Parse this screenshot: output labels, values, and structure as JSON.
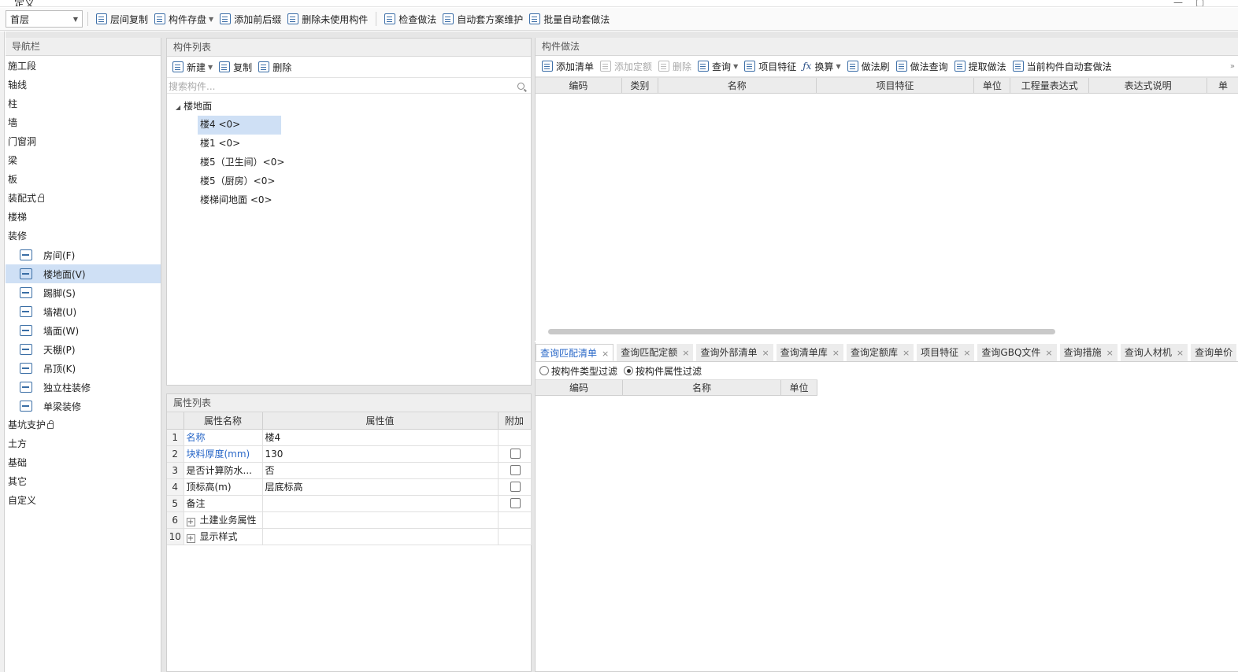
{
  "window": {
    "title": "定义"
  },
  "toolbar": {
    "floor": "首层",
    "buttons": [
      "层间复制",
      "构件存盘",
      "添加前后缀",
      "删除未使用构件",
      "检查做法",
      "自动套方案维护",
      "批量自动套做法"
    ]
  },
  "nav": {
    "title": "导航栏",
    "items_top": [
      "施工段",
      "轴线",
      "柱",
      "墙",
      "门窗洞",
      "梁",
      "板",
      "装配式",
      "楼梯",
      "装修"
    ],
    "sub_items": [
      "房间(F)",
      "楼地面(V)",
      "踢脚(S)",
      "墙裙(U)",
      "墙面(W)",
      "天棚(P)",
      "吊顶(K)",
      "独立柱装修",
      "单梁装修"
    ],
    "items_bottom": [
      "基坑支护",
      "土方",
      "基础",
      "其它",
      "自定义"
    ]
  },
  "complist": {
    "title": "构件列表",
    "buttons": [
      "新建",
      "复制",
      "删除"
    ],
    "search_placeholder": "搜索构件...",
    "root": "楼地面",
    "items": [
      "楼4 <0>",
      "楼1 <0>",
      "楼5（卫生间）<0>",
      "楼5（厨房）<0>",
      "楼梯间地面 <0>"
    ]
  },
  "props": {
    "title": "属性列表",
    "headers": [
      "属性名称",
      "属性值",
      "附加"
    ],
    "rows": [
      {
        "num": "1",
        "name": "名称",
        "value": "楼4"
      },
      {
        "num": "2",
        "name": "块料厚度(mm)",
        "value": "130"
      },
      {
        "num": "3",
        "name": "是否计算防水...",
        "value": "否"
      },
      {
        "num": "4",
        "name": "顶标高(m)",
        "value": "层底标高"
      },
      {
        "num": "5",
        "name": "备注",
        "value": ""
      },
      {
        "num": "6",
        "name": "土建业务属性",
        "value": ""
      },
      {
        "num": "10",
        "name": "显示样式",
        "value": ""
      }
    ]
  },
  "method": {
    "title": "构件做法",
    "buttons": [
      "添加清单",
      "添加定额",
      "删除",
      "查询",
      "项目特征",
      "换算",
      "做法刷",
      "做法查询",
      "提取做法",
      "当前构件自动套做法"
    ],
    "headers": [
      "编码",
      "类别",
      "名称",
      "项目特征",
      "单位",
      "工程量表达式",
      "表达式说明",
      "单"
    ]
  },
  "query": {
    "tabs": [
      "查询匹配清单",
      "查询匹配定额",
      "查询外部清单",
      "查询清单库",
      "查询定额库",
      "项目特征",
      "查询GBQ文件",
      "查询措施",
      "查询人材机",
      "查询单价"
    ],
    "filters": [
      "按构件类型过滤",
      "按构件属性过滤"
    ],
    "headers": [
      "编码",
      "名称",
      "单位"
    ]
  }
}
